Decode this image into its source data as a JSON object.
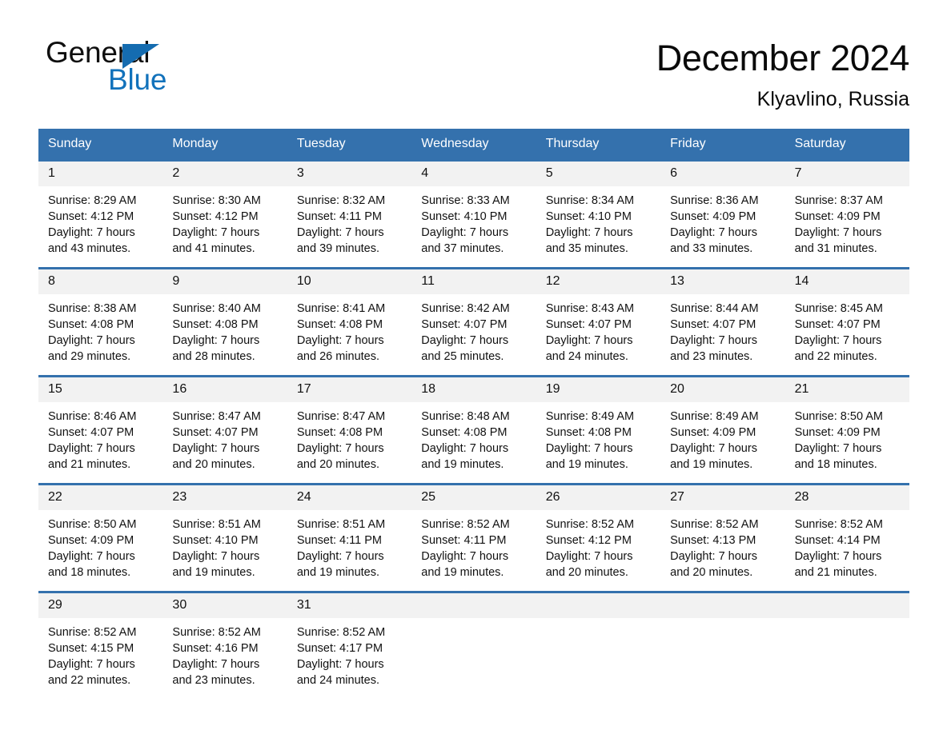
{
  "brand": {
    "word_general": "General",
    "word_blue": "Blue",
    "logo_icon": "triangle-logo-icon",
    "accent_color": "#156cb0",
    "blue_text_color": "#1272bb"
  },
  "header": {
    "title": "December 2024",
    "subtitle": "Klyavlino, Russia",
    "header_bg_color": "#3471ad",
    "daynum_bg_color": "#f2f2f2"
  },
  "weekdays": [
    "Sunday",
    "Monday",
    "Tuesday",
    "Wednesday",
    "Thursday",
    "Friday",
    "Saturday"
  ],
  "weeks": [
    [
      {
        "day": "1",
        "sunrise": "Sunrise: 8:29 AM",
        "sunset": "Sunset: 4:12 PM",
        "daylight_line1": "Daylight: 7 hours",
        "daylight_line2": "and 43 minutes."
      },
      {
        "day": "2",
        "sunrise": "Sunrise: 8:30 AM",
        "sunset": "Sunset: 4:12 PM",
        "daylight_line1": "Daylight: 7 hours",
        "daylight_line2": "and 41 minutes."
      },
      {
        "day": "3",
        "sunrise": "Sunrise: 8:32 AM",
        "sunset": "Sunset: 4:11 PM",
        "daylight_line1": "Daylight: 7 hours",
        "daylight_line2": "and 39 minutes."
      },
      {
        "day": "4",
        "sunrise": "Sunrise: 8:33 AM",
        "sunset": "Sunset: 4:10 PM",
        "daylight_line1": "Daylight: 7 hours",
        "daylight_line2": "and 37 minutes."
      },
      {
        "day": "5",
        "sunrise": "Sunrise: 8:34 AM",
        "sunset": "Sunset: 4:10 PM",
        "daylight_line1": "Daylight: 7 hours",
        "daylight_line2": "and 35 minutes."
      },
      {
        "day": "6",
        "sunrise": "Sunrise: 8:36 AM",
        "sunset": "Sunset: 4:09 PM",
        "daylight_line1": "Daylight: 7 hours",
        "daylight_line2": "and 33 minutes."
      },
      {
        "day": "7",
        "sunrise": "Sunrise: 8:37 AM",
        "sunset": "Sunset: 4:09 PM",
        "daylight_line1": "Daylight: 7 hours",
        "daylight_line2": "and 31 minutes."
      }
    ],
    [
      {
        "day": "8",
        "sunrise": "Sunrise: 8:38 AM",
        "sunset": "Sunset: 4:08 PM",
        "daylight_line1": "Daylight: 7 hours",
        "daylight_line2": "and 29 minutes."
      },
      {
        "day": "9",
        "sunrise": "Sunrise: 8:40 AM",
        "sunset": "Sunset: 4:08 PM",
        "daylight_line1": "Daylight: 7 hours",
        "daylight_line2": "and 28 minutes."
      },
      {
        "day": "10",
        "sunrise": "Sunrise: 8:41 AM",
        "sunset": "Sunset: 4:08 PM",
        "daylight_line1": "Daylight: 7 hours",
        "daylight_line2": "and 26 minutes."
      },
      {
        "day": "11",
        "sunrise": "Sunrise: 8:42 AM",
        "sunset": "Sunset: 4:07 PM",
        "daylight_line1": "Daylight: 7 hours",
        "daylight_line2": "and 25 minutes."
      },
      {
        "day": "12",
        "sunrise": "Sunrise: 8:43 AM",
        "sunset": "Sunset: 4:07 PM",
        "daylight_line1": "Daylight: 7 hours",
        "daylight_line2": "and 24 minutes."
      },
      {
        "day": "13",
        "sunrise": "Sunrise: 8:44 AM",
        "sunset": "Sunset: 4:07 PM",
        "daylight_line1": "Daylight: 7 hours",
        "daylight_line2": "and 23 minutes."
      },
      {
        "day": "14",
        "sunrise": "Sunrise: 8:45 AM",
        "sunset": "Sunset: 4:07 PM",
        "daylight_line1": "Daylight: 7 hours",
        "daylight_line2": "and 22 minutes."
      }
    ],
    [
      {
        "day": "15",
        "sunrise": "Sunrise: 8:46 AM",
        "sunset": "Sunset: 4:07 PM",
        "daylight_line1": "Daylight: 7 hours",
        "daylight_line2": "and 21 minutes."
      },
      {
        "day": "16",
        "sunrise": "Sunrise: 8:47 AM",
        "sunset": "Sunset: 4:07 PM",
        "daylight_line1": "Daylight: 7 hours",
        "daylight_line2": "and 20 minutes."
      },
      {
        "day": "17",
        "sunrise": "Sunrise: 8:47 AM",
        "sunset": "Sunset: 4:08 PM",
        "daylight_line1": "Daylight: 7 hours",
        "daylight_line2": "and 20 minutes."
      },
      {
        "day": "18",
        "sunrise": "Sunrise: 8:48 AM",
        "sunset": "Sunset: 4:08 PM",
        "daylight_line1": "Daylight: 7 hours",
        "daylight_line2": "and 19 minutes."
      },
      {
        "day": "19",
        "sunrise": "Sunrise: 8:49 AM",
        "sunset": "Sunset: 4:08 PM",
        "daylight_line1": "Daylight: 7 hours",
        "daylight_line2": "and 19 minutes."
      },
      {
        "day": "20",
        "sunrise": "Sunrise: 8:49 AM",
        "sunset": "Sunset: 4:09 PM",
        "daylight_line1": "Daylight: 7 hours",
        "daylight_line2": "and 19 minutes."
      },
      {
        "day": "21",
        "sunrise": "Sunrise: 8:50 AM",
        "sunset": "Sunset: 4:09 PM",
        "daylight_line1": "Daylight: 7 hours",
        "daylight_line2": "and 18 minutes."
      }
    ],
    [
      {
        "day": "22",
        "sunrise": "Sunrise: 8:50 AM",
        "sunset": "Sunset: 4:09 PM",
        "daylight_line1": "Daylight: 7 hours",
        "daylight_line2": "and 18 minutes."
      },
      {
        "day": "23",
        "sunrise": "Sunrise: 8:51 AM",
        "sunset": "Sunset: 4:10 PM",
        "daylight_line1": "Daylight: 7 hours",
        "daylight_line2": "and 19 minutes."
      },
      {
        "day": "24",
        "sunrise": "Sunrise: 8:51 AM",
        "sunset": "Sunset: 4:11 PM",
        "daylight_line1": "Daylight: 7 hours",
        "daylight_line2": "and 19 minutes."
      },
      {
        "day": "25",
        "sunrise": "Sunrise: 8:52 AM",
        "sunset": "Sunset: 4:11 PM",
        "daylight_line1": "Daylight: 7 hours",
        "daylight_line2": "and 19 minutes."
      },
      {
        "day": "26",
        "sunrise": "Sunrise: 8:52 AM",
        "sunset": "Sunset: 4:12 PM",
        "daylight_line1": "Daylight: 7 hours",
        "daylight_line2": "and 20 minutes."
      },
      {
        "day": "27",
        "sunrise": "Sunrise: 8:52 AM",
        "sunset": "Sunset: 4:13 PM",
        "daylight_line1": "Daylight: 7 hours",
        "daylight_line2": "and 20 minutes."
      },
      {
        "day": "28",
        "sunrise": "Sunrise: 8:52 AM",
        "sunset": "Sunset: 4:14 PM",
        "daylight_line1": "Daylight: 7 hours",
        "daylight_line2": "and 21 minutes."
      }
    ],
    [
      {
        "day": "29",
        "sunrise": "Sunrise: 8:52 AM",
        "sunset": "Sunset: 4:15 PM",
        "daylight_line1": "Daylight: 7 hours",
        "daylight_line2": "and 22 minutes."
      },
      {
        "day": "30",
        "sunrise": "Sunrise: 8:52 AM",
        "sunset": "Sunset: 4:16 PM",
        "daylight_line1": "Daylight: 7 hours",
        "daylight_line2": "and 23 minutes."
      },
      {
        "day": "31",
        "sunrise": "Sunrise: 8:52 AM",
        "sunset": "Sunset: 4:17 PM",
        "daylight_line1": "Daylight: 7 hours",
        "daylight_line2": "and 24 minutes."
      },
      {
        "day": "",
        "sunrise": "",
        "sunset": "",
        "daylight_line1": "",
        "daylight_line2": ""
      },
      {
        "day": "",
        "sunrise": "",
        "sunset": "",
        "daylight_line1": "",
        "daylight_line2": ""
      },
      {
        "day": "",
        "sunrise": "",
        "sunset": "",
        "daylight_line1": "",
        "daylight_line2": ""
      },
      {
        "day": "",
        "sunrise": "",
        "sunset": "",
        "daylight_line1": "",
        "daylight_line2": ""
      }
    ]
  ]
}
